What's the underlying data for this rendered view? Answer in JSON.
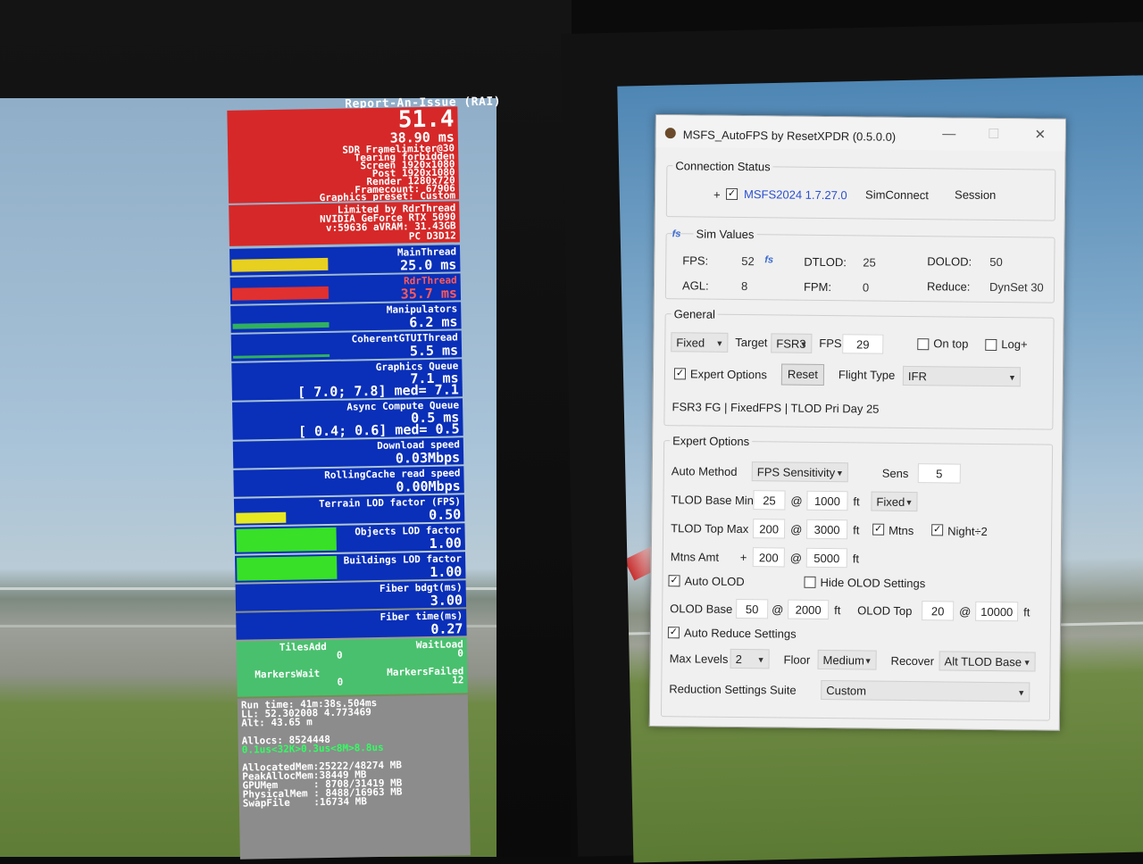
{
  "rai": {
    "title": "Report-An-Issue (RAI)",
    "fps": "51.4",
    "frame_ms": "38.90 ms",
    "info_lines": [
      "SDR Framelimiter@30",
      "Tearing forbidden",
      "Screen 1920x1080",
      "Post 1920x1080",
      "Render 1280x720",
      "Framecount: 67906",
      "Graphics preset: Custom"
    ],
    "gpu_lines": [
      "Limited by RdrThread",
      "NVIDIA GeForce RTX 5090",
      "v:59636 aVRAM: 31.43GB",
      "PC D3D12"
    ],
    "threads": [
      {
        "name": "MainThread",
        "value": "25.0 ms",
        "name_color": "#ffffff",
        "value_color": "#ffffff"
      },
      {
        "name": "RdrThread",
        "value": "35.7 ms",
        "name_color": "#ff5a5a",
        "value_color": "#ff5a5a"
      },
      {
        "name": "Manipulators",
        "value": "6.2 ms",
        "name_color": "#ffffff",
        "value_color": "#ffffff"
      },
      {
        "name": "CoherentGTUIThread",
        "value": "5.5 ms",
        "name_color": "#ffffff",
        "value_color": "#ffffff"
      }
    ],
    "graphics_queue": {
      "name": "Graphics Queue",
      "value": "7.1 ms",
      "range": "[ 7.0; 7.8] med= 7.1"
    },
    "async_queue": {
      "name": "Async Compute Queue",
      "value": "0.5 ms",
      "range": "[ 0.4; 0.6] med= 0.5"
    },
    "download": {
      "name": "Download speed",
      "value": "0.03Mbps"
    },
    "rolling": {
      "name": "RollingCache read speed",
      "value": "0.00Mbps"
    },
    "lod": [
      {
        "name": "Terrain LOD factor (FPS)",
        "value": "0.50",
        "fill": 0.5,
        "color": "#e8e820"
      },
      {
        "name": "Objects LOD factor",
        "value": "1.00",
        "fill": 1.0,
        "color": "#38e028"
      },
      {
        "name": "Buildings LOD factor",
        "value": "1.00",
        "fill": 1.0,
        "color": "#38e028"
      }
    ],
    "fiber_budget": {
      "name": "Fiber bdgt(ms)",
      "value": "3.00"
    },
    "fiber_time": {
      "name": "Fiber time(ms)",
      "value": "0.27"
    },
    "tiles": {
      "tiles_add_label": "TilesAdd",
      "tiles_add": "0",
      "wait_load_label": "WaitLoad",
      "wait_load": "0",
      "markers_wait_label": "MarkersWait",
      "markers_wait": "0",
      "markers_failed_label": "MarkersFailed",
      "markers_failed": "12"
    },
    "stats": {
      "run_time": "Run time: 41m:38s.504ms",
      "ll": "LL: 52.302008 4.773469",
      "alt": "Alt: 43.65 m",
      "allocs": "Allocs: 8524448",
      "alloc_times": "0.1us<32K>0.3us<8M>8.8us",
      "allocated_mem": "AllocatedMem:25222/48274 MB",
      "peak_alloc": "PeakAllocMem:38449 MB",
      "gpu_mem": "GPUMem      : 8708/31419 MB",
      "physical_mem": "PhysicalMem : 8488/16963 MB",
      "swap": "SwapFile    :16734 MB"
    }
  },
  "window": {
    "title": "MSFS_AutoFPS by ResetXPDR (0.5.0.0)",
    "minimize": "—",
    "maximize": "☐",
    "close": "✕",
    "connection": {
      "title": "Connection Status",
      "plus": "+",
      "sim_checked": true,
      "sim": "MSFS2024 1.7.27.0",
      "simconnect": "SimConnect",
      "session": "Session"
    },
    "sim_values": {
      "title": "Sim Values",
      "fps_label": "FPS:",
      "fps": "52",
      "dtlod_label": "DTLOD:",
      "dtlod": "25",
      "dolod_label": "DOLOD:",
      "dolod": "50",
      "agl_label": "AGL:",
      "agl": "8",
      "fpm_label": "FPM:",
      "fpm": "0",
      "reduce_label": "Reduce:",
      "reduce": "DynSet 30"
    },
    "general": {
      "title": "General",
      "mode": "Fixed",
      "target_label": "Target",
      "target": "FSR3",
      "fps_label": "FPS",
      "fps": "29",
      "ontop_label": "On top",
      "ontop_checked": false,
      "log_label": "Log+",
      "log_checked": false,
      "expert_label": "Expert Options",
      "expert_checked": true,
      "reset_label": "Reset",
      "flight_type_label": "Flight Type",
      "flight_type": "IFR",
      "summary": "FSR3 FG | FixedFPS | TLOD Pri Day 25"
    },
    "expert": {
      "title": "Expert Options",
      "auto_method_label": "Auto Method",
      "auto_method": "FPS Sensitivity",
      "sens_label": "Sens",
      "sens": "5",
      "tlod_base_label": "TLOD Base Min",
      "tlod_base": "25",
      "tlod_base_alt": "1000",
      "at": "@",
      "ft": "ft",
      "tlod_base_mode": "Fixed",
      "tlod_top_label": "TLOD Top Max",
      "tlod_top": "200",
      "tlod_top_alt": "3000",
      "mtns_label": "Mtns",
      "mtns_checked": true,
      "night_label": "Night÷2",
      "night_checked": true,
      "mtns_amt_label": "Mtns Amt",
      "mtns_plus": "+",
      "mtns_amt": "200",
      "mtns_amt_alt": "5000",
      "auto_olod_label": "Auto OLOD",
      "auto_olod_checked": true,
      "hide_olod_label": "Hide OLOD Settings",
      "hide_olod_checked": false,
      "olod_base_label": "OLOD Base",
      "olod_base": "50",
      "olod_base_alt": "2000",
      "olod_top_label": "OLOD Top",
      "olod_top": "20",
      "olod_top_alt": "10000",
      "auto_reduce_label": "Auto Reduce Settings",
      "auto_reduce_checked": true,
      "max_levels_label": "Max Levels",
      "max_levels": "2",
      "floor_label": "Floor",
      "floor": "Medium",
      "recover_label": "Recover",
      "recover": "Alt TLOD Base",
      "suite_label": "Reduction Settings Suite",
      "suite": "Custom"
    }
  }
}
